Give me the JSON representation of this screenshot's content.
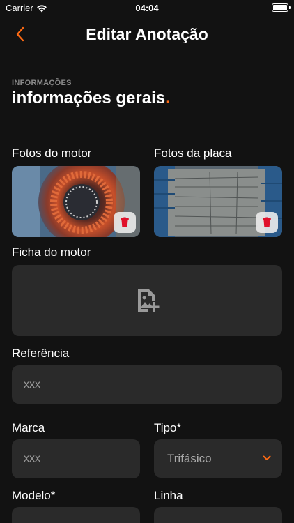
{
  "status_bar": {
    "carrier": "Carrier",
    "time": "04:04"
  },
  "nav": {
    "title": "Editar Anotação",
    "back_icon": "chevron-left-icon"
  },
  "section": {
    "kicker": "INFORMAÇÕES",
    "title": "informações gerais",
    "title_dot": "."
  },
  "photos": {
    "motor_label": "Fotos do motor",
    "plate_label": "Fotos da placa"
  },
  "motor_sheet": {
    "label": "Ficha do motor",
    "icon": "add-image-icon"
  },
  "fields": {
    "referencia": {
      "label": "Referência",
      "placeholder": "xxx"
    },
    "marca": {
      "label": "Marca",
      "placeholder": "xxx"
    },
    "tipo": {
      "label": "Tipo*",
      "value": "Trifásico"
    },
    "modelo": {
      "label": "Modelo*"
    },
    "linha": {
      "label": "Linha"
    }
  },
  "colors": {
    "accent": "#ff6a13",
    "background": "#121212",
    "field": "#2a2a2a",
    "danger": "#e0112b"
  }
}
